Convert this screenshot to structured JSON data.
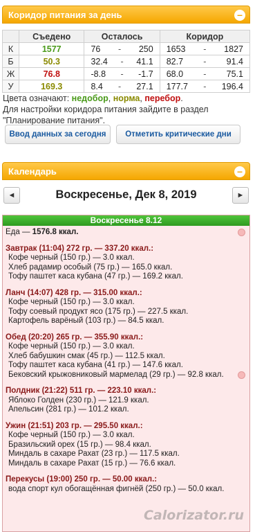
{
  "nutrition_panel": {
    "title": "Коридор питания за день",
    "headers": [
      "",
      "Съедено",
      "Осталось",
      "Коридор"
    ],
    "rows": [
      {
        "label": "К",
        "eaten": "1577",
        "eaten_class": "green",
        "left_from": "76",
        "left_to": "250",
        "corr_from": "1653",
        "corr_to": "1827"
      },
      {
        "label": "Б",
        "eaten": "50.3",
        "eaten_class": "olive",
        "left_from": "32.4",
        "left_to": "41.1",
        "corr_from": "82.7",
        "corr_to": "91.4"
      },
      {
        "label": "Ж",
        "eaten": "76.8",
        "eaten_class": "red",
        "left_from": "-8.8",
        "left_to": "-1.7",
        "corr_from": "68.0",
        "corr_to": "75.1"
      },
      {
        "label": "У",
        "eaten": "169.3",
        "eaten_class": "olive",
        "left_from": "8.4",
        "left_to": "27.1",
        "corr_from": "177.7",
        "corr_to": "196.4"
      }
    ],
    "dash": "-",
    "legend_prefix": "Цвета означают: ",
    "legend_under": "недобор",
    "legend_norm": "норма",
    "legend_over": "перебор",
    "legend_settings": "Для настройки коридора питания зайдите в раздел \"Планирование питания\".",
    "btn_enter": "Ввод данных за сегодня",
    "btn_critical": "Отметить критические дни"
  },
  "calendar_panel": {
    "title": "Календарь",
    "prev": "◄",
    "next": "►",
    "date_title": "Воскресенье, Дек 8, 2019",
    "day_header": "Воскресенье 8.12",
    "food_total_prefix": "Еда — ",
    "food_total_value": "1576.8 ккал.",
    "meals": [
      {
        "title": "Завтрак (11:04) 272 гр. — 337.20 ккал.:",
        "items": [
          "Кофе черный (150 гр.) — 3.0 ккал.",
          "Хлеб радамир особый (75 гр.) — 165.0 ккал.",
          "Тофу паштет каса кубана (47 гр.) — 169.2 ккал."
        ]
      },
      {
        "title": "Ланч (14:07) 428 гр. — 315.00 ккал.:",
        "items": [
          "Кофе черный (150 гр.) — 3.0 ккал.",
          "Тофу соевый продукт ясо (175 гр.) — 227.5 ккал.",
          "Картофель варёный (103 гр.) — 84.5 ккал."
        ]
      },
      {
        "title": "Обед (20:20) 265 гр. — 355.90 ккал.:",
        "items": [
          "Кофе черный (150 гр.) — 3.0 ккал.",
          "Хлеб бабушкин смак (45 гр.) — 112.5 ккал.",
          "Тофу паштет каса кубана (41 гр.) — 147.6 ккал.",
          "Бековский крыжовниковый мармелад (29 гр.) — 92.8 ккал."
        ]
      },
      {
        "title": "Полдник (21:22) 511 гр. — 223.10 ккал.:",
        "items": [
          "Яблоко Голден (230 гр.) — 121.9 ккал.",
          "Апельсин (281 гр.) — 101.2 ккал."
        ]
      },
      {
        "title": "Ужин (21:51) 203 гр. — 295.50 ккал.:",
        "items": [
          "Кофе черный (150 гр.) — 3.0 ккал.",
          "Бразильский орех (15 гр.) — 98.4 ккал.",
          "Миндаль в сахаре Рахат (23 гр.) — 117.5 ккал.",
          "Миндаль в сахаре Рахат (15 гр.) — 76.6 ккал."
        ]
      },
      {
        "title": "Перекусы (19:00) 250 гр. — 50.00 ккал.:",
        "items": [
          "вода спорт кул обогащённая фигнёй (250 гр.) — 50.0 ккал."
        ]
      }
    ]
  },
  "watermark": "Calorizator.ru",
  "colors": {
    "green": "#4a9a1a",
    "olive": "#8a8a00",
    "red": "#c01010",
    "accent": "#f5a700"
  }
}
